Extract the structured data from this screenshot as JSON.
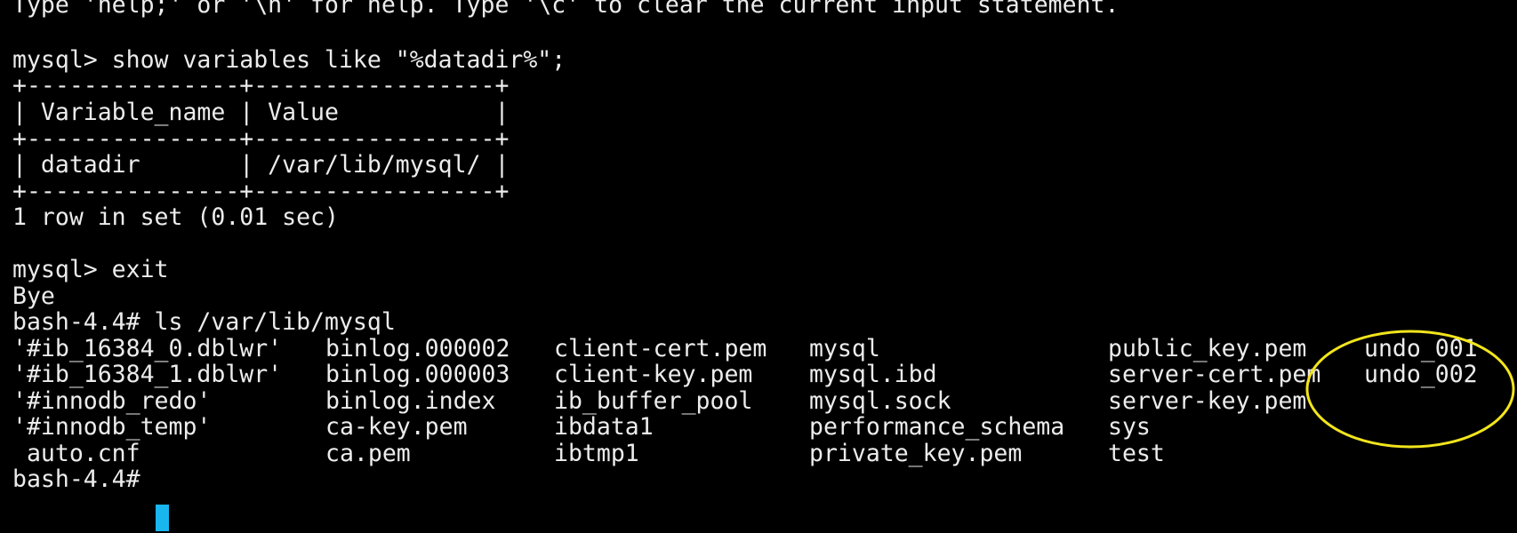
{
  "terminal": {
    "lines": [
      "Type 'help;' or '\\h' for help. Type '\\c' to clear the current input statement.",
      "",
      "mysql> show variables like \"%datadir%\";",
      "+---------------+-----------------+",
      "| Variable_name | Value           |",
      "+---------------+-----------------+",
      "| datadir       | /var/lib/mysql/ |",
      "+---------------+-----------------+",
      "1 row in set (0.01 sec)",
      "",
      "mysql> exit",
      "Bye",
      "bash-4.4# ls /var/lib/mysql"
    ],
    "ls_columns": [
      [
        "'#ib_16384_0.dblwr'",
        "'#ib_16384_1.dblwr'",
        "'#innodb_redo'",
        "'#innodb_temp'",
        " auto.cnf"
      ],
      [
        "binlog.000002",
        "binlog.000003",
        "binlog.index",
        "ca-key.pem",
        "ca.pem"
      ],
      [
        "client-cert.pem",
        "client-key.pem",
        "ib_buffer_pool",
        "ibdata1",
        "ibtmp1"
      ],
      [
        "mysql",
        "mysql.ibd",
        "mysql.sock",
        "performance_schema",
        "private_key.pem"
      ],
      [
        "public_key.pem",
        "server-cert.pem",
        "server-key.pem",
        "sys",
        "test"
      ],
      [
        "undo_001",
        "undo_002"
      ]
    ],
    "prompt": "bash-4.4# ",
    "colors": {
      "background": "#000000",
      "foreground": "#ececec",
      "cursor": "#19b5ee",
      "highlight_circle": "#f2e51c"
    }
  }
}
